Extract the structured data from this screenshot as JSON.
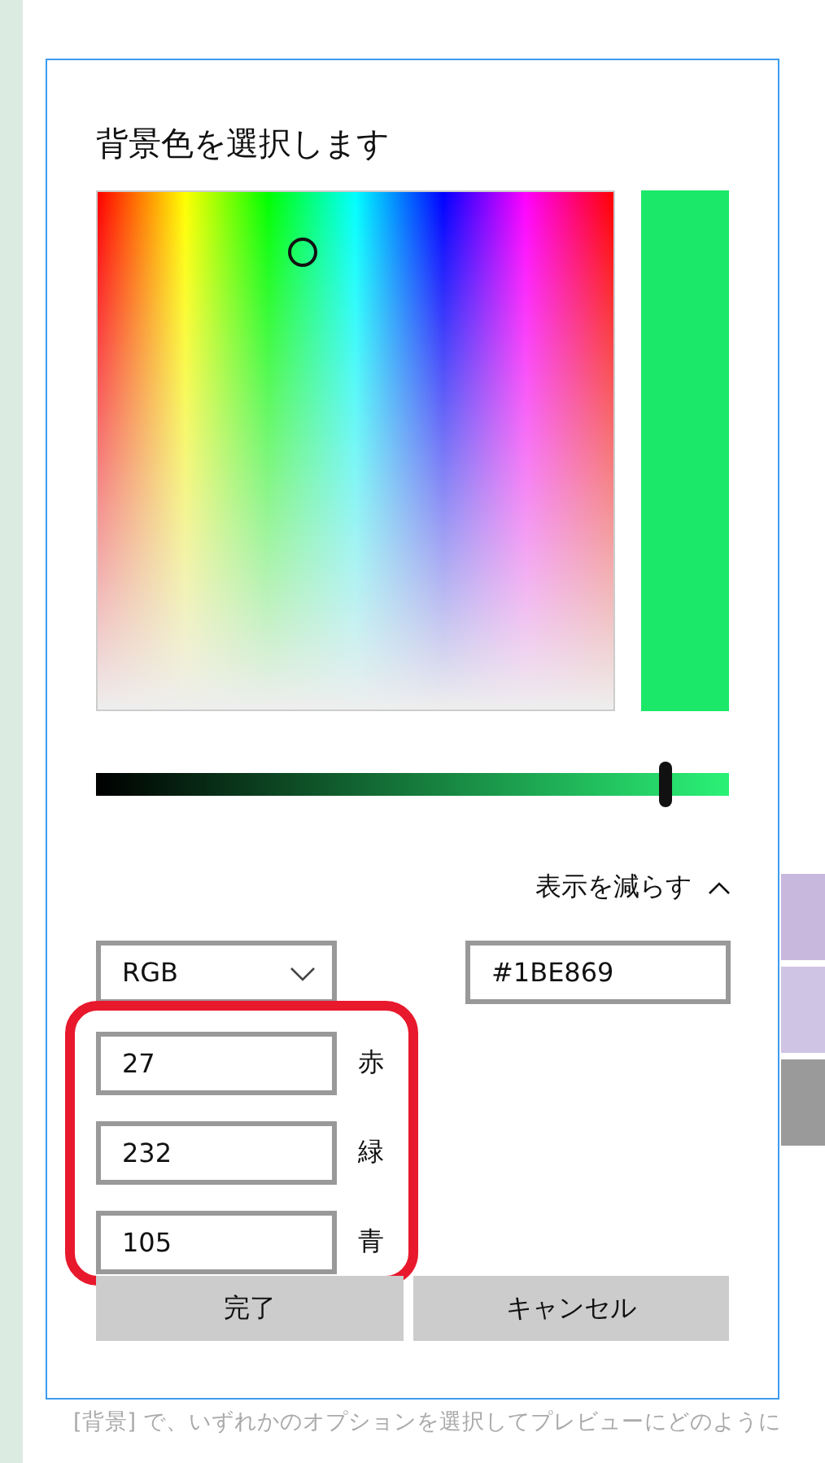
{
  "background_page": {
    "description_lines": [
      "[背景] で、いずれかのオプションを選択してプレビューにどのように"
    ],
    "side_tiles": [
      {
        "color": "#c8b8de"
      },
      {
        "color": "#d0c4e4"
      },
      {
        "color": "#9a9a9a"
      }
    ]
  },
  "dialog": {
    "title": "背景色を選択します",
    "hex": "#1BE869",
    "brightness": {
      "level": 0.9
    },
    "toggle": {
      "label": "表示を減らす",
      "expanded": true
    },
    "mode_dropdown": {
      "value": "RGB"
    },
    "channels": [
      {
        "value": "27",
        "label": "赤"
      },
      {
        "value": "232",
        "label": "緑"
      },
      {
        "value": "105",
        "label": "青"
      }
    ],
    "highlight": {
      "kind": "rounded-rectangle"
    },
    "buttons": [
      {
        "label": "完了"
      },
      {
        "label": "キャンセル"
      }
    ]
  }
}
